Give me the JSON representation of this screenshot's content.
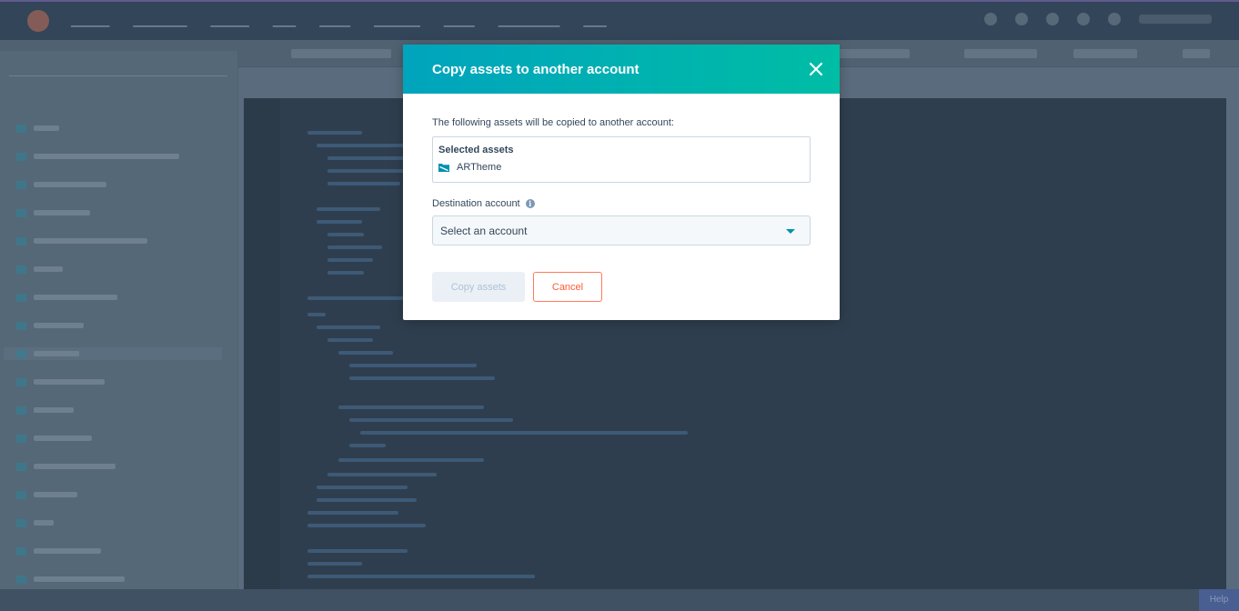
{
  "modal": {
    "title": "Copy assets to another account",
    "intro": "The following assets will be copied to another account:",
    "selected_heading": "Selected assets",
    "selected_items": [
      {
        "label": "ARTheme",
        "icon": "theme-folder-icon"
      }
    ],
    "destination_label": "Destination account",
    "destination_placeholder": "Select an account",
    "copy_button": "Copy assets",
    "cancel_button": "Cancel"
  },
  "statusbar": {
    "help_label": "Help"
  },
  "colors": {
    "header_gradient_start": "#00a4bd",
    "header_gradient_end": "#00bda5",
    "cancel_accent": "#ff5c35",
    "text": "#33475b",
    "dropdown_caret": "#0091ae"
  }
}
